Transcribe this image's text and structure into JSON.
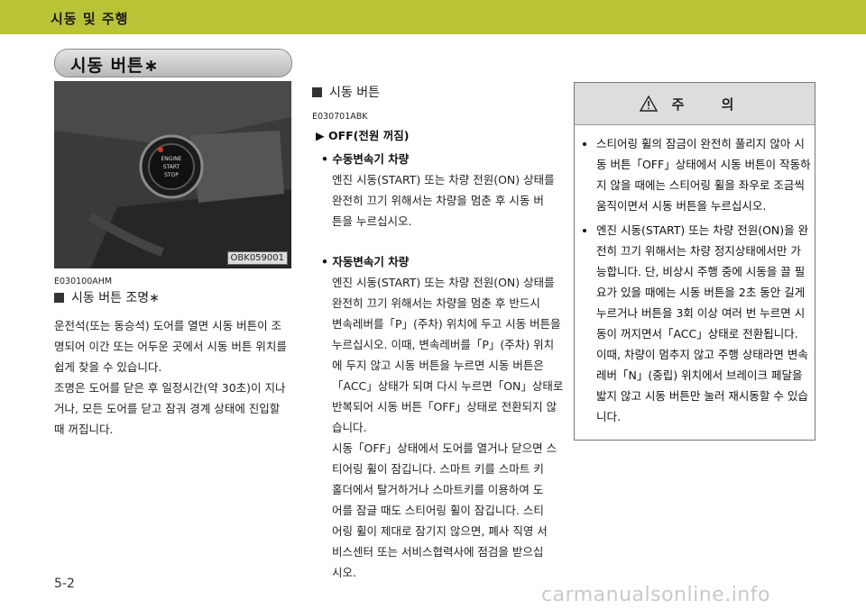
{
  "header": {
    "section": "시동 및 주행"
  },
  "section_title": "시동 버튼∗",
  "photo": {
    "code": "OBK059001",
    "button_text": [
      "ENGINE",
      "START",
      "STOP"
    ]
  },
  "left": {
    "code": "E030100AHM",
    "heading": "시동 버튼 조명∗",
    "paragraph": [
      "운전석(또는 동승석) 도어를 열면 시동 버튼이 조",
      "명되어 이간 또는 어두운 곳에서 시동 버튼 위치를",
      "쉽게 찾을 수 있습니다.",
      "조명은 도어를 닫은 후 일정시간(약 30초)이 지나",
      "거나, 모든 도어를 닫고 잠궈 경계 상태에 진입할",
      "때 꺼집니다."
    ]
  },
  "middle": {
    "heading": "시동 버튼",
    "code": "E030701ABK",
    "sub": "▶ OFF(전원 꺼짐)",
    "manual_title": "• 수동변속기 차량",
    "manual_text": [
      "엔진 시동(START) 또는 차량 전원(ON) 상태를",
      "완전히 끄기 위해서는 차량을 멈춘 후 시동 버",
      "튼을 누르십시오."
    ],
    "auto_title": "• 자동변속기 차량",
    "auto_text": [
      "엔진 시동(START) 또는 차량 전원(ON) 상태를",
      "완전히 끄기 위해서는 차량을 멈춘 후 반드시",
      "변속레버를「P」(주차) 위치에 두고 시동 버튼을",
      "누르십시오. 이때, 변속레버를「P」(주차)  위치",
      "에 두지 않고 시동 버튼을 누르면 시동 버튼은",
      "「ACC」상태가 되며 다시 누르면「ON」상태로",
      "반복되어 시동 버튼「OFF」상태로 전환되지 않",
      "습니다."
    ],
    "closing_text": [
      "시동「OFF」상태에서 도어를 열거나 닫으면 스",
      "티어링 휠이 잠깁니다. 스마트 키를 스마트 키",
      "홀더에서 탈거하거나 스마트키를 이용하여 도",
      "어를 잠글 때도 스티어링 휠이 잠깁니다. 스티",
      "어링 휠이 제대로 잠기지 않으면, 폐사 직영 서",
      "비스센터 또는 서비스협력사에 점검을 받으십",
      "시오."
    ]
  },
  "caution": {
    "title": "주 의",
    "items": [
      "스티어링 휠의 잠금이 완전히 풀리지 않아 시동 버튼「OFF」상태에서 시동 버튼이 작동하지 않을 때에는 스티어링 휠을 좌우로 조금씩 움직이면서 시동 버튼을 누르십시오.",
      "엔진 시동(START) 또는 차량 전원(ON)을 완전히 끄기 위해서는 차량 정지상태에서만 가능합니다. 단, 비상시 주행 중에 시동을 끌 필요가 있을 때에는 시동 버튼을 2초 동안 길게 누르거나 버튼을 3회 이상 여러 번 누르면 시동이 꺼지면서「ACC」상태로 전환됩니다. 이때, 차량이 멈추지 않고 주행 상태라면 변속레버「N」(중립) 위치에서 브레이크 페달을 밟지 않고 시동 버튼만 눌러 재시동할 수 있습니다."
    ]
  },
  "page_number": "5-2",
  "watermark": "carmanualsonline.info"
}
